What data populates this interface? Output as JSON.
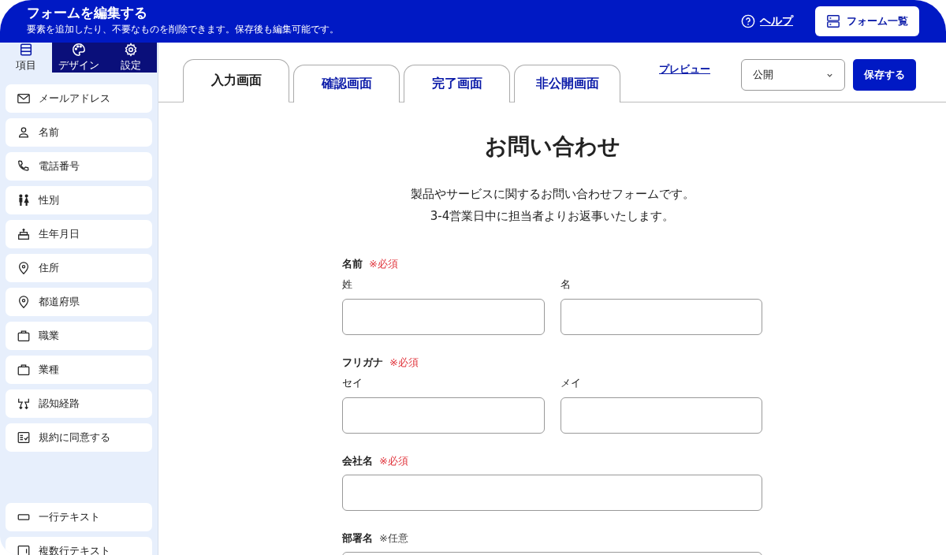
{
  "header": {
    "title": "フォームを編集する",
    "subtitle": "要素を追加したり、不要なものを削除できます。保存後も編集可能です。",
    "help": "ヘルプ",
    "form_list": "フォーム一覧"
  },
  "sidebar": {
    "tabs": [
      {
        "label": "項目",
        "selected": true
      },
      {
        "label": "デザイン",
        "selected": false
      },
      {
        "label": "設定",
        "selected": false
      }
    ],
    "items": [
      {
        "label": "メールアドレス",
        "kind": "mail"
      },
      {
        "label": "名前",
        "kind": "person"
      },
      {
        "label": "電話番号",
        "kind": "phone"
      },
      {
        "label": "性別",
        "kind": "gender"
      },
      {
        "label": "生年月日",
        "kind": "cake"
      },
      {
        "label": "住所",
        "kind": "address"
      },
      {
        "label": "都道府県",
        "kind": "prefecture"
      },
      {
        "label": "職業",
        "kind": "job"
      },
      {
        "label": "業種",
        "kind": "industry"
      },
      {
        "label": "認知経路",
        "kind": "route"
      },
      {
        "label": "規約に同意する",
        "kind": "agree"
      }
    ],
    "basic_items": [
      {
        "label": "一行テキスト",
        "kind": "line"
      },
      {
        "label": "複数行テキスト",
        "kind": "multi"
      }
    ]
  },
  "screen_tabs": [
    {
      "label": "入力画面",
      "selected": true
    },
    {
      "label": "確認画面",
      "selected": false
    },
    {
      "label": "完了画面",
      "selected": false
    },
    {
      "label": "非公開画面",
      "selected": false
    }
  ],
  "toolbar": {
    "preview": "プレビュー",
    "status": "公開",
    "save": "保存する"
  },
  "form": {
    "title": "お問い合わせ",
    "description": [
      "製品やサービスに関するお問い合わせフォームです。",
      "3-4営業日中に担当者よりお返事いたします。"
    ],
    "fields": [
      {
        "label": "名前",
        "note": "※必須",
        "required": true,
        "inputs": [
          "姓",
          "名"
        ]
      },
      {
        "label": "フリガナ",
        "note": "※必須",
        "required": true,
        "inputs": [
          "セイ",
          "メイ"
        ]
      },
      {
        "label": "会社名",
        "note": "※必須",
        "required": true
      },
      {
        "label": "部署名",
        "note": "※任意",
        "required": false
      }
    ]
  }
}
